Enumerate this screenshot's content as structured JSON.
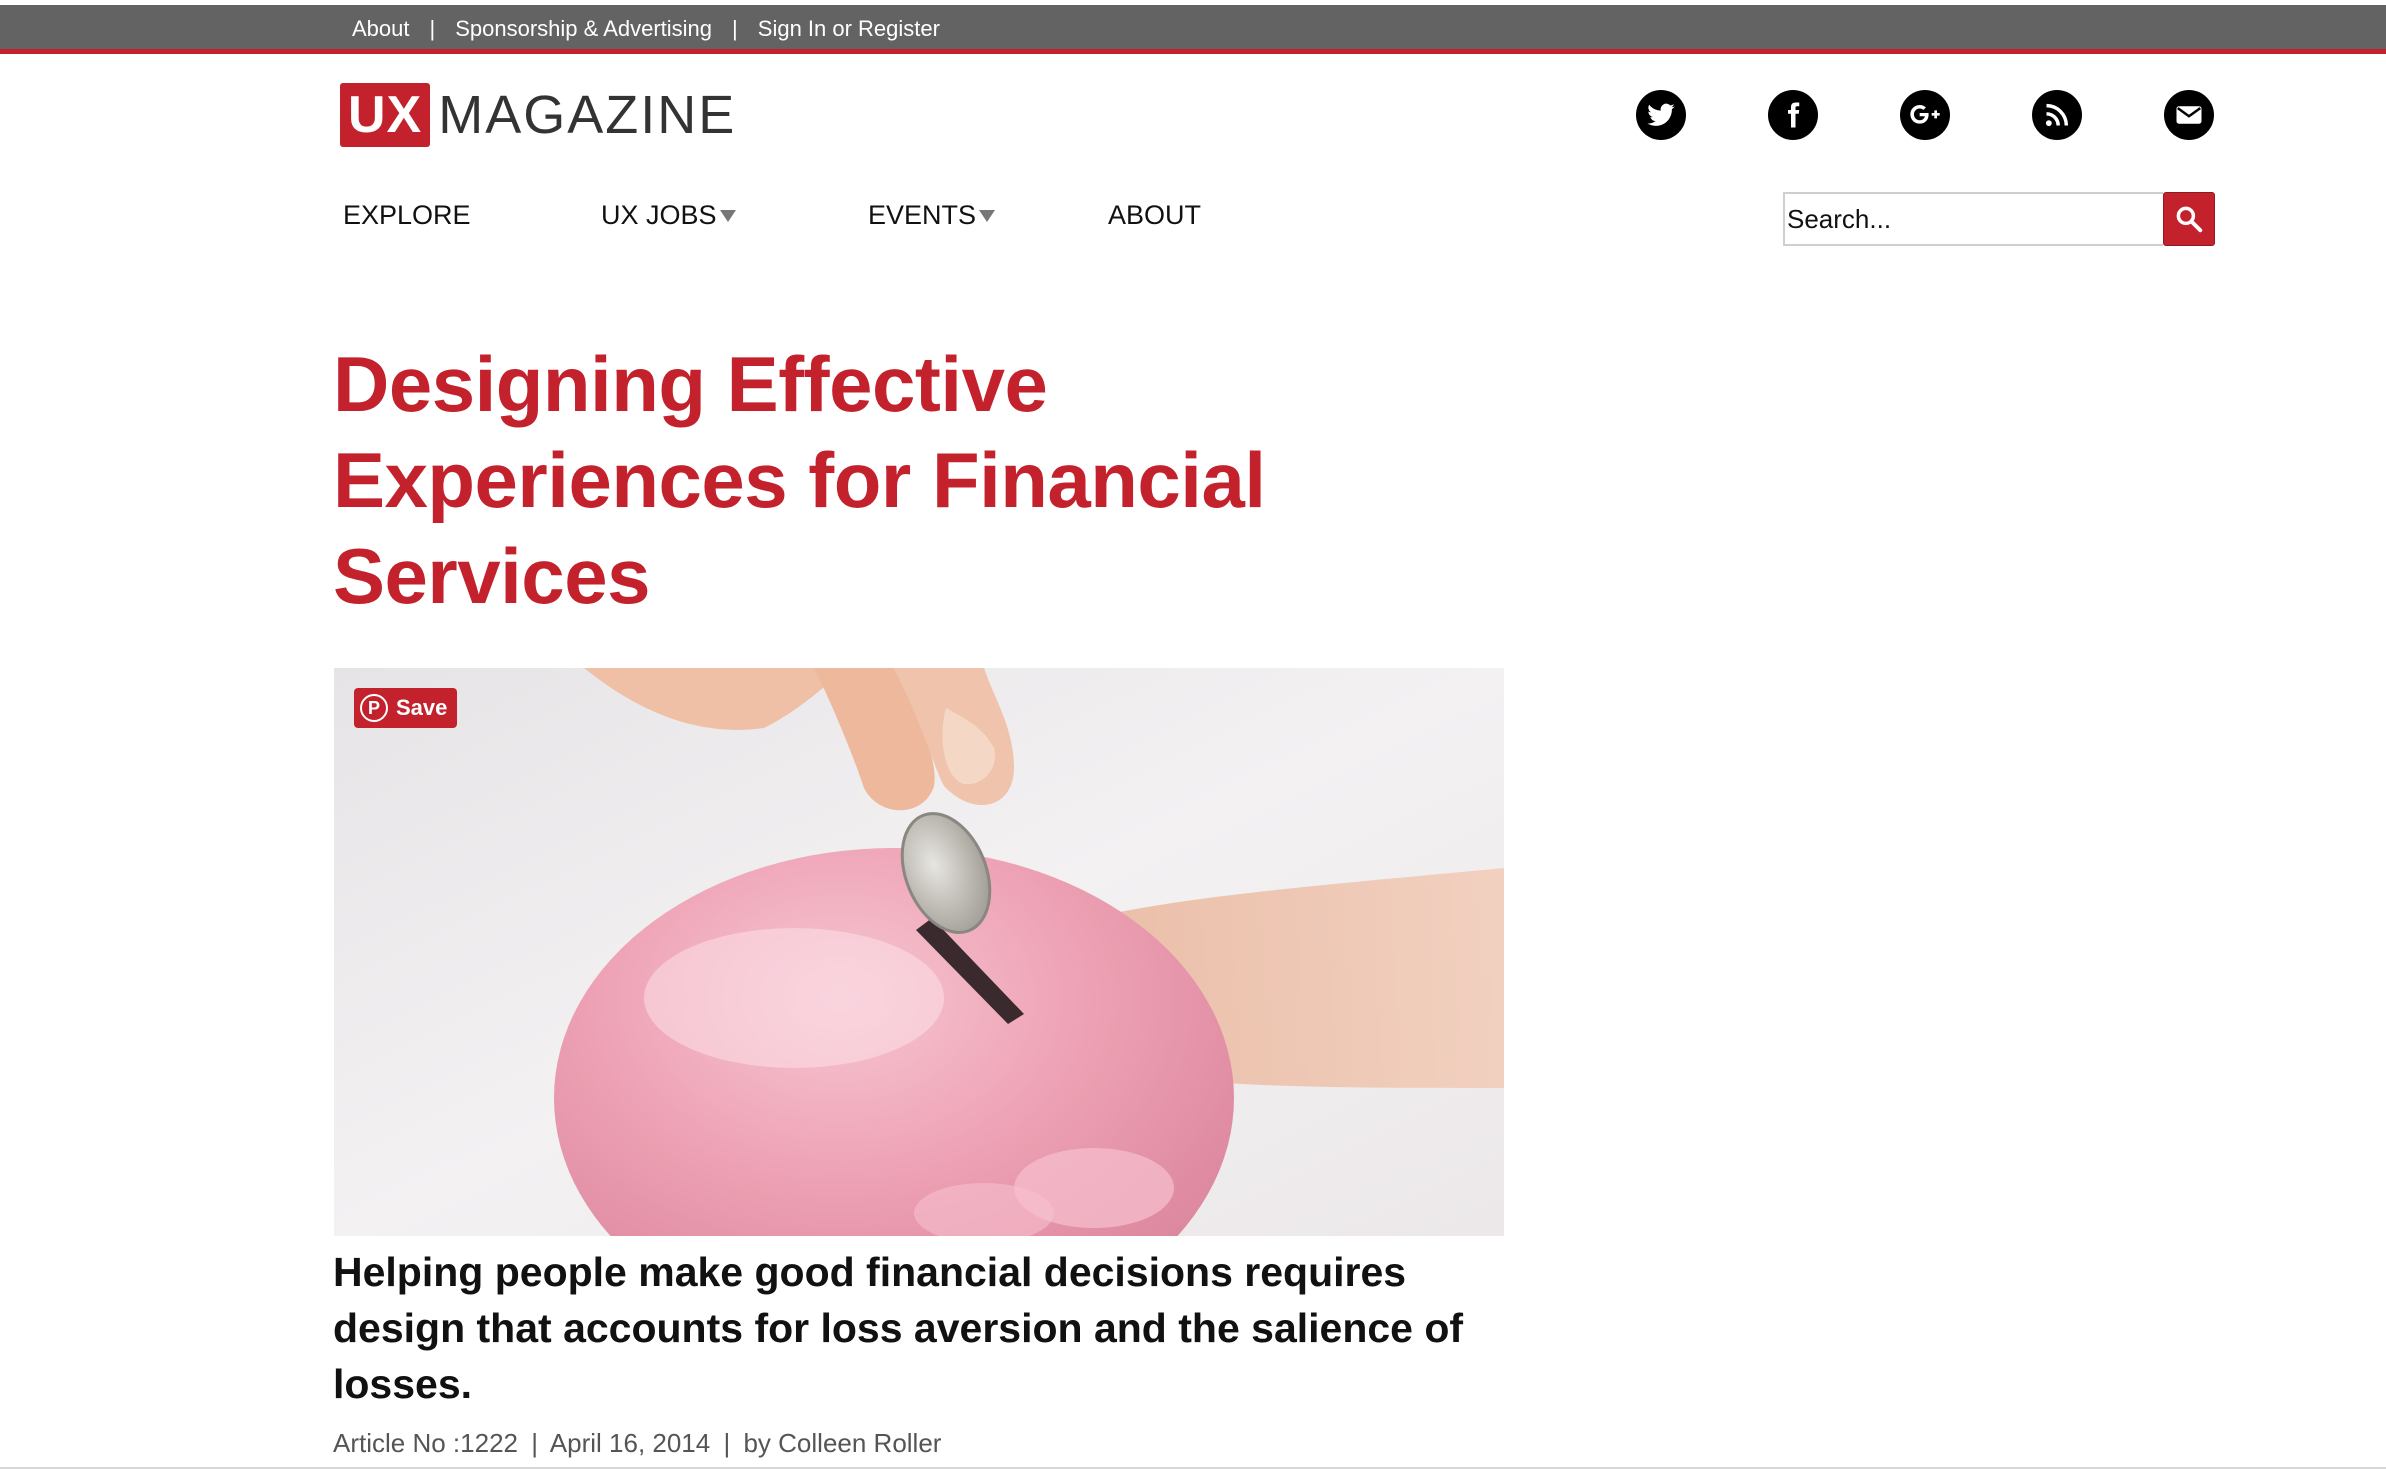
{
  "topbar": {
    "links": [
      "About",
      "Sponsorship & Advertising",
      "Sign In or Register"
    ],
    "separator": "|"
  },
  "header": {
    "logo_box": "UX",
    "logo_text": "MAGAZINE",
    "social_icons": [
      "twitter-icon",
      "facebook-icon",
      "google-plus-icon",
      "rss-icon",
      "email-icon"
    ]
  },
  "nav": {
    "items": [
      {
        "label": "EXPLORE",
        "dropdown": false
      },
      {
        "label": "UX JOBS",
        "dropdown": true
      },
      {
        "label": "EVENTS",
        "dropdown": true
      },
      {
        "label": "ABOUT",
        "dropdown": false
      }
    ]
  },
  "search": {
    "placeholder": "Search...",
    "icon": "search-icon"
  },
  "article": {
    "title": "Designing Effective Experiences for Financial Services",
    "image_save_label": "Save",
    "deck": "Helping people make good financial decisions requires design that accounts for loss aversion and the salience of losses.",
    "meta": {
      "article_no": "Article No :1222",
      "date": "April 16, 2014",
      "author": "by Colleen Roller",
      "separator": "|"
    }
  },
  "colors": {
    "brand_red": "#c3222d",
    "topbar_gray": "#636363"
  }
}
